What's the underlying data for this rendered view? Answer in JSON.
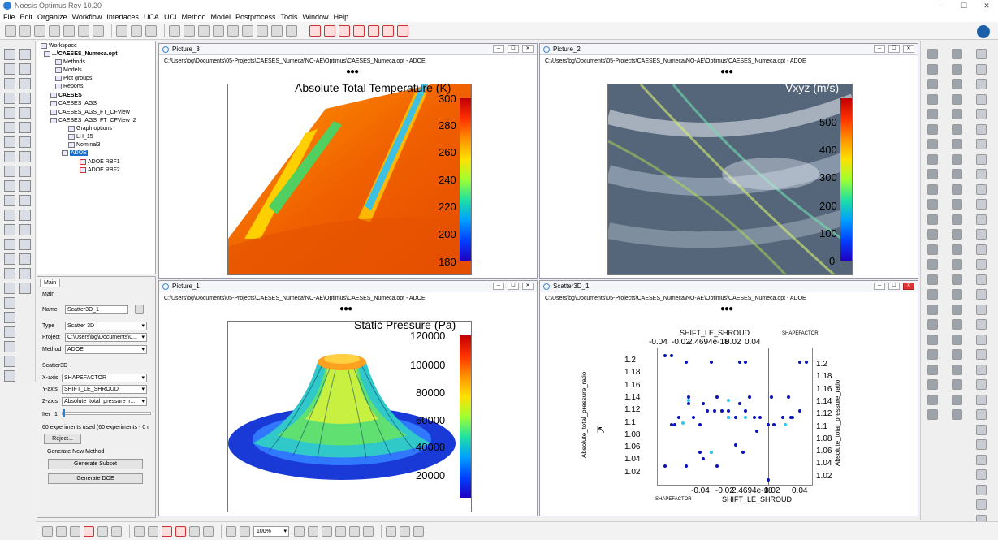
{
  "app": {
    "title": "Noesis Optimus Rev 10.20"
  },
  "menu": [
    "File",
    "Edit",
    "Organize",
    "Workflow",
    "Interfaces",
    "UCA",
    "UCI",
    "Method",
    "Model",
    "Postprocess",
    "Tools",
    "Window",
    "Help"
  ],
  "tree": {
    "workspace": "Workspace",
    "root": "...\\CAESES_Numeca.opt",
    "items": [
      "Methods",
      "Models",
      "Plot groups",
      "Reports",
      "CAESES",
      "CAESES_AGS",
      "CAESES_AGS_FT_CFView",
      "CAESES_AGS_FT_CFView_2",
      "Graph options",
      "LH_15",
      "Nominal3",
      "ADOE",
      "ADOE RBF1",
      "ADOE RBF2"
    ]
  },
  "props": {
    "tab": "Main",
    "section": "Main",
    "name_label": "Name",
    "name_value": "Scatter3D_1",
    "type_label": "Type",
    "type_value": "Scatter 3D",
    "project_label": "Project",
    "project_value": "C:\\Users\\bg\\Documents\\0...",
    "method_label": "Method",
    "method_value": "ADOE",
    "scatter_label": "Scatter3D",
    "xaxis_label": "X-axis",
    "xaxis_value": "SHAPEFACTOR",
    "yaxis_label": "Y-axis",
    "yaxis_value": "SHIFT_LE_SHROUD",
    "zaxis_label": "Z-axis",
    "zaxis_value": "Absolute_total_pressure_r...",
    "iter_label": "Iter",
    "iter_value": "1",
    "experiments": "60 experiments used (60 experiments - 0 r",
    "reject_button": "Reject...",
    "gen_new_method": "Generate New Method",
    "gen_subset_button": "Generate Subset",
    "gen_doe_button": "Generate DOE"
  },
  "panels": {
    "p3": {
      "title": "Picture_3",
      "path": "C:\\Users\\bg\\Documents\\05-Projects\\CAESES_Numeca\\NO-AE\\Optimus\\CAESES_Numeca.opt - ADOE",
      "cb_title": "Absolute Total Temperature (K)",
      "ticks": [
        "300",
        "280",
        "260",
        "240",
        "220",
        "200",
        "180"
      ]
    },
    "p2": {
      "title": "Picture_2",
      "path": "C:\\Users\\bg\\Documents\\05-Projects\\CAESES_Numeca\\NO-AE\\Optimus\\CAESES_Numeca.opt - ADOE",
      "cb_title": "Vxyz (m/s)",
      "ticks": [
        "500",
        "400",
        "300",
        "200",
        "100",
        "0"
      ]
    },
    "p1": {
      "title": "Picture_1",
      "path": "C:\\Users\\bg\\Documents\\05-Projects\\CAESES_Numeca\\NO-AE\\Optimus\\CAESES_Numeca.opt - ADOE",
      "cb_title": "Static Pressure (Pa)",
      "ticks": [
        "120000",
        "100000",
        "80000",
        "60000",
        "40000",
        "20000"
      ]
    },
    "s3d": {
      "title": "Scatter3D_1",
      "path": "C:\\Users\\bg\\Documents\\05-Projects\\CAESES_Numeca\\NO-AE\\Optimus\\CAESES_Numeca.opt - ADOE"
    }
  },
  "zoom": "100%",
  "chart_data": {
    "type": "scatter",
    "title": "",
    "xlabel": "SHIFT_LE_SHROUD",
    "ylabel": "Absolute_total_pressure_ratio",
    "zlabel": "SHAPEFACTOR",
    "x_ticks": [
      "-0.04",
      "-0.02",
      "2.4694e-18",
      "0.02",
      "0.04"
    ],
    "y_ticks": [
      "1.2",
      "1.18",
      "1.16",
      "1.14",
      "1.12",
      "1.1",
      "1.08",
      "1.06",
      "1.04",
      "1.02"
    ],
    "top_ticks": [
      "-0.04",
      "-0.02",
      "2.4694e-18",
      "0.02",
      "0.04"
    ],
    "right_ticks": [
      "1.2",
      "1.18",
      "1.16",
      "1.14",
      "1.12",
      "1.1",
      "1.08",
      "1.06",
      "1.04",
      "1.02"
    ],
    "points": [
      [
        -0.045,
        1.2
      ],
      [
        -0.04,
        1.2
      ],
      [
        -0.03,
        1.19
      ],
      [
        -0.012,
        1.19
      ],
      [
        0.008,
        1.19
      ],
      [
        0.012,
        1.19
      ],
      [
        0.05,
        1.19
      ],
      [
        0.055,
        1.19
      ],
      [
        -0.028,
        1.14
      ],
      [
        -0.018,
        1.13
      ],
      [
        -0.008,
        1.14
      ],
      [
        0.0,
        1.12
      ],
      [
        0.008,
        1.13
      ],
      [
        0.015,
        1.14
      ],
      [
        0.03,
        1.14
      ],
      [
        0.042,
        1.14
      ],
      [
        -0.04,
        1.1
      ],
      [
        -0.02,
        1.1
      ],
      [
        -0.025,
        1.11
      ],
      [
        -0.015,
        1.12
      ],
      [
        -0.005,
        1.12
      ],
      [
        0.005,
        1.11
      ],
      [
        0.012,
        1.12
      ],
      [
        0.022,
        1.11
      ],
      [
        0.032,
        1.1
      ],
      [
        0.038,
        1.11
      ],
      [
        0.044,
        1.11
      ],
      [
        0.05,
        1.12
      ],
      [
        -0.045,
        1.04
      ],
      [
        -0.03,
        1.04
      ],
      [
        -0.02,
        1.06
      ],
      [
        -0.012,
        1.06
      ],
      [
        -0.018,
        1.05
      ],
      [
        -0.008,
        1.04
      ],
      [
        0.005,
        1.07
      ],
      [
        0.01,
        1.06
      ],
      [
        0.02,
        1.09
      ],
      [
        0.028,
        1.02
      ],
      [
        -0.035,
        1.11
      ],
      [
        -0.028,
        1.13
      ],
      [
        -0.01,
        1.12
      ],
      [
        0.0,
        1.11
      ],
      [
        0.018,
        1.11
      ],
      [
        0.028,
        1.1
      ],
      [
        0.045,
        1.11
      ],
      [
        -0.038,
        1.1
      ]
    ],
    "highlight": [
      [
        -0.028,
        1.135
      ],
      [
        -0.032,
        1.102
      ],
      [
        0.0,
        1.135
      ],
      [
        0.012,
        1.11
      ],
      [
        0.04,
        1.1
      ],
      [
        -0.012,
        1.06
      ],
      [
        0.0,
        1.11
      ]
    ]
  }
}
